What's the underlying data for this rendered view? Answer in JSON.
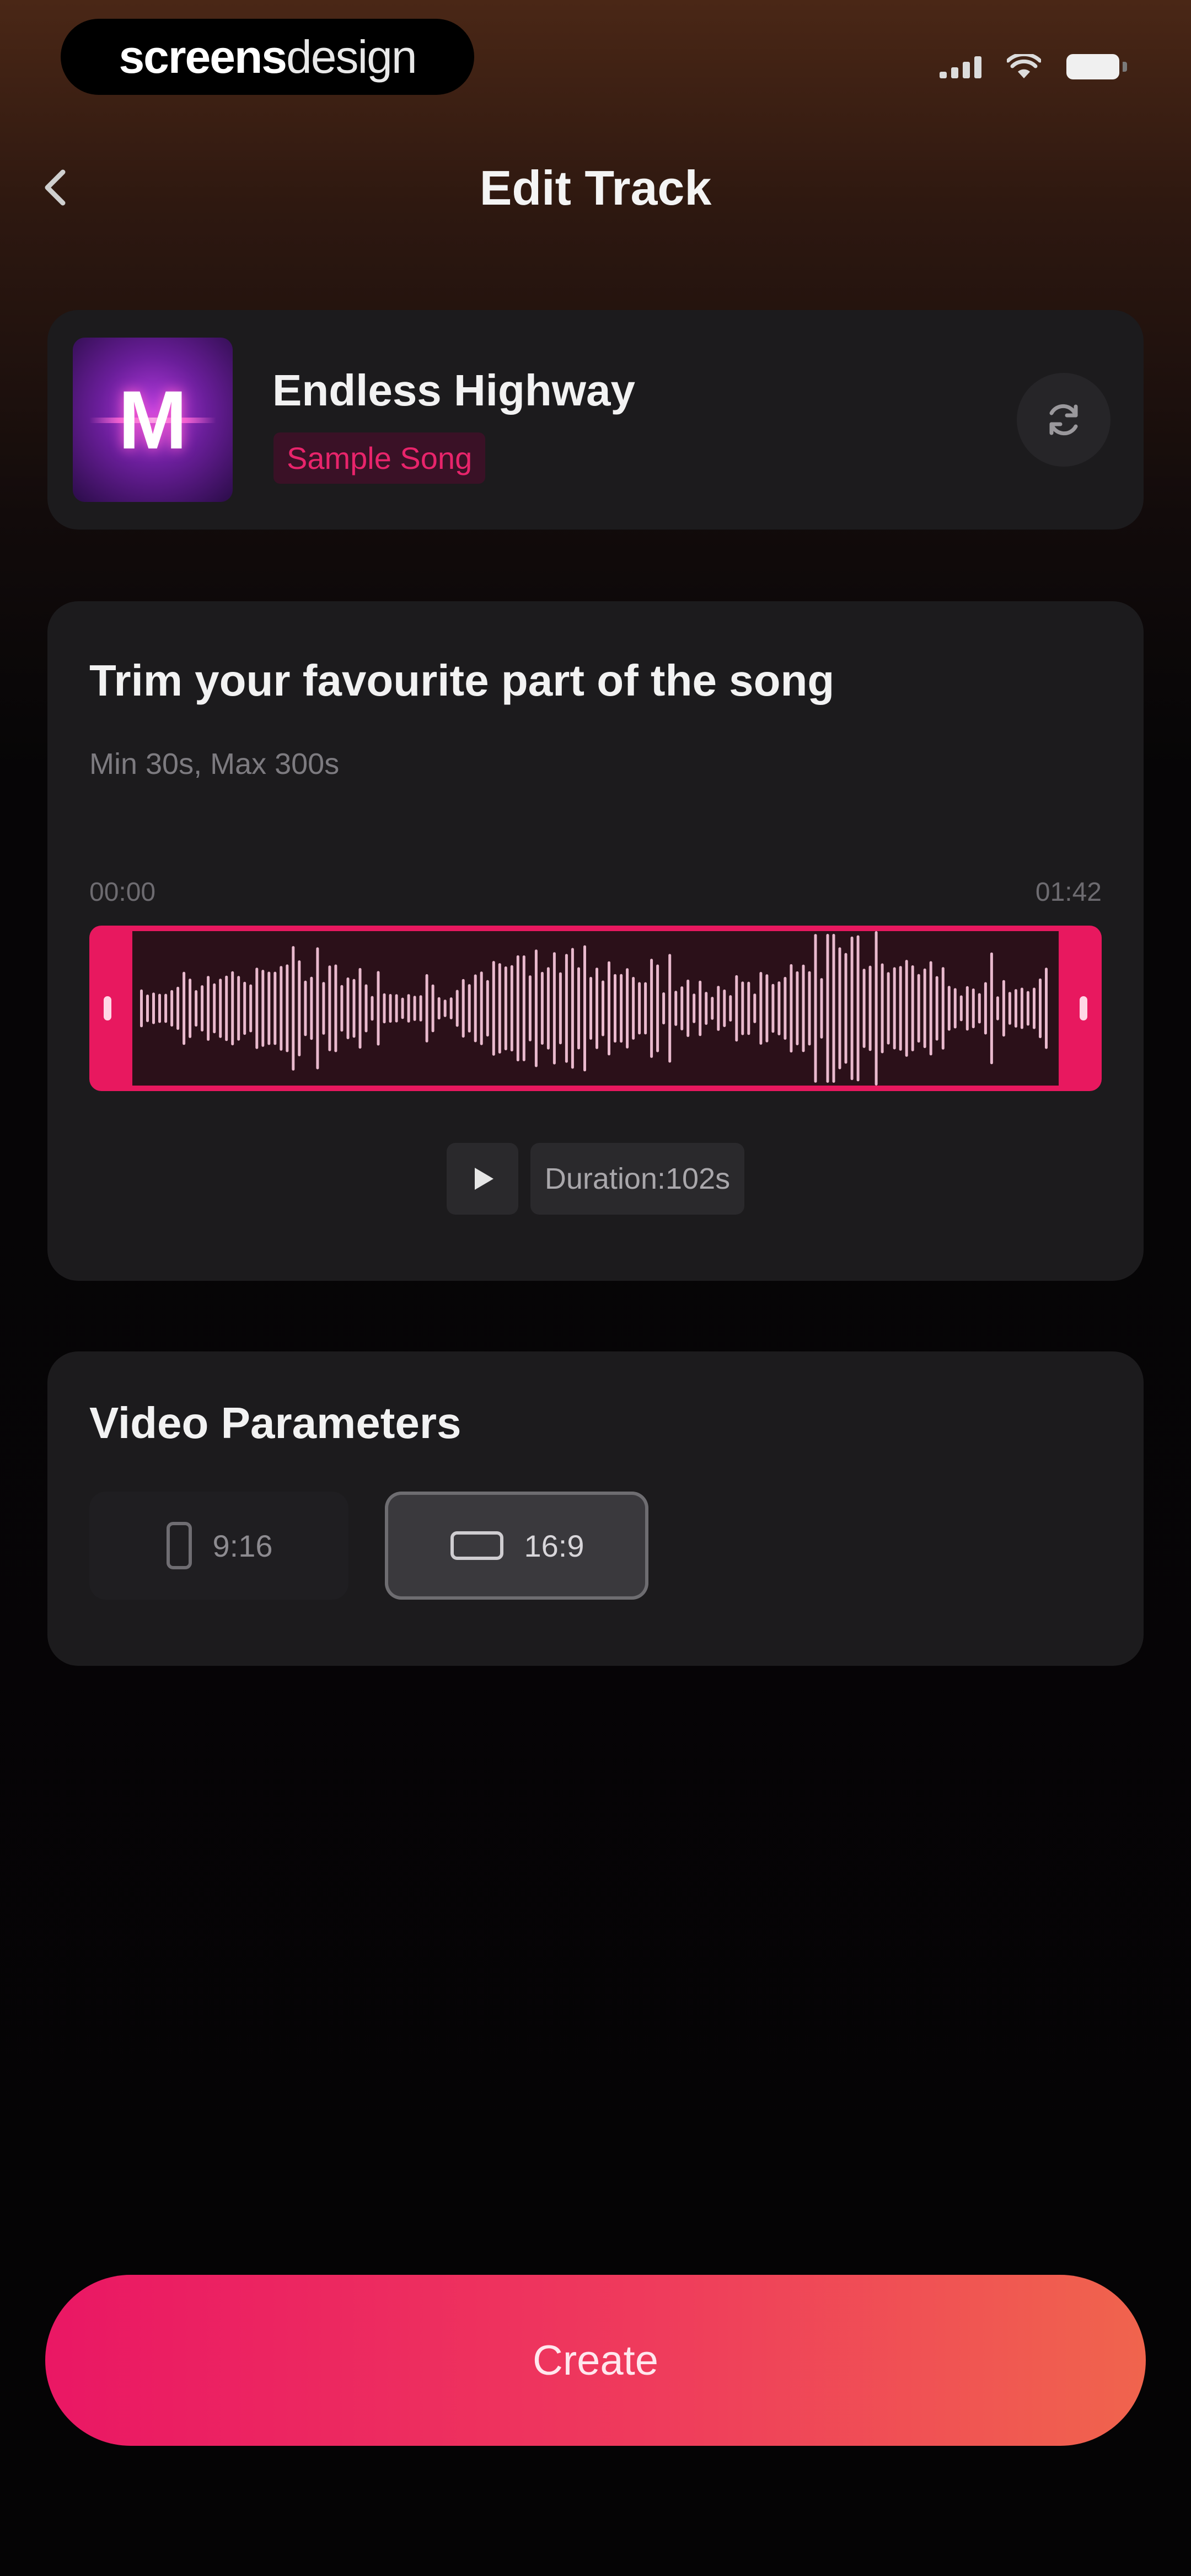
{
  "status_bar": {
    "brand_part1": "screens",
    "brand_part2": "design"
  },
  "header": {
    "back_icon": "chevron-left-icon",
    "title": "Edit Track"
  },
  "track": {
    "title": "Endless Highway",
    "badge": "Sample Song",
    "art_letter": "M",
    "replace_icon": "refresh-icon"
  },
  "trim": {
    "title": "Trim your favourite part of the song",
    "hint": "Min 30s, Max 300s",
    "time_start": "00:00",
    "time_end": "01:42",
    "play_icon": "play-icon",
    "duration_label": "Duration:102s"
  },
  "video": {
    "title": "Video Parameters",
    "options": [
      {
        "label": "9:16",
        "icon": "portrait-phone-icon",
        "selected": false
      },
      {
        "label": "16:9",
        "icon": "landscape-screen-icon",
        "selected": true
      }
    ]
  },
  "actions": {
    "create_label": "Create"
  },
  "colors": {
    "accent": "#ea1764",
    "accent_end": "#f0644d",
    "card": "#1c1b1d"
  }
}
